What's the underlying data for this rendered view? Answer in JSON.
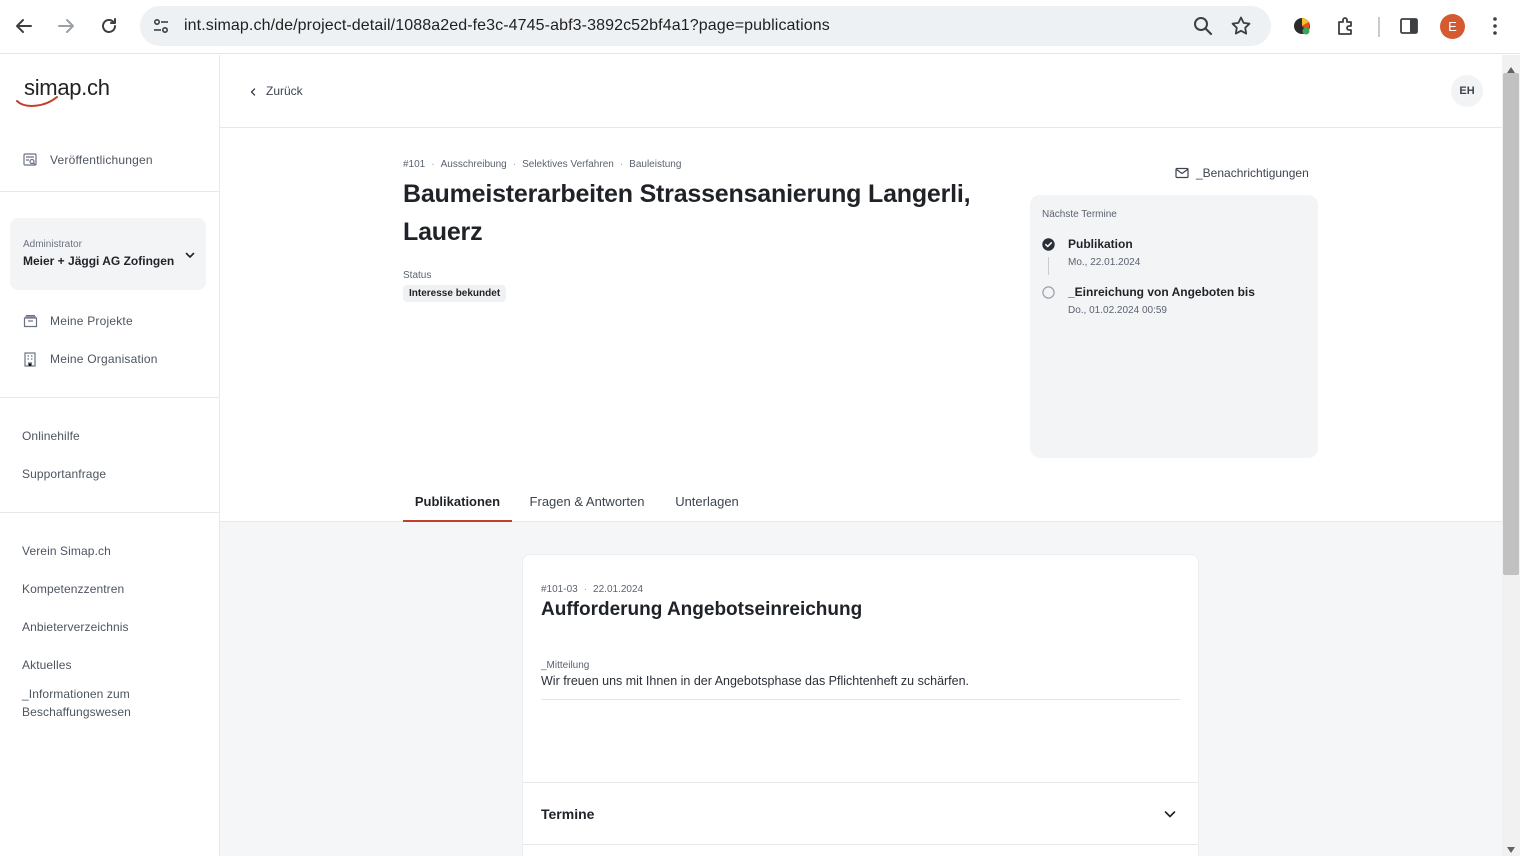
{
  "browser": {
    "url": "int.simap.ch/de/project-detail/1088a2ed-fe3c-4745-abf3-3892c52bf4a1?page=publications",
    "profile_initial": "E"
  },
  "sidebar": {
    "logo_text": "simap.ch",
    "publications_label": "Veröffentlichungen",
    "org": {
      "role": "Administrator",
      "name": "Meier + Jäggi AG Zofingen"
    },
    "projects_label": "Meine Projekte",
    "organisation_label": "Meine Organisation",
    "help_links": [
      "Onlinehilfe",
      "Supportanfrage"
    ],
    "footer_links": [
      "Verein Simap.ch",
      "Kompetenzzentren",
      "Anbieterverzeichnis",
      "Aktuelles"
    ],
    "info_link": [
      "_Informationen zum",
      "Beschaffungswesen"
    ]
  },
  "header": {
    "back_label": "Zurück",
    "avatar_initials": "EH"
  },
  "project": {
    "number": "#101",
    "type": "Ausschreibung",
    "procedure": "Selektives Verfahren",
    "category": "Bauleistung",
    "title": "Baumeisterarbeiten Strassensanierung Langerli, Lauerz",
    "status_label": "Status",
    "status_value": "Interesse bekundet",
    "notifications_label": "_Benachrichtigungen"
  },
  "next_dates": {
    "header": "Nächste Termine",
    "items": [
      {
        "label": "Publikation",
        "date": "Mo., 22.01.2024",
        "done": true
      },
      {
        "label": "_Einreichung von Angeboten bis",
        "date": "Do., 01.02.2024 00:59",
        "done": false
      }
    ]
  },
  "tabs": [
    {
      "label": "Publikationen",
      "active": true
    },
    {
      "label": "Fragen & Antworten",
      "active": false
    },
    {
      "label": "Unterlagen",
      "active": false
    }
  ],
  "publication": {
    "number": "#101-03",
    "date": "22.01.2024",
    "title": "Aufforderung Angebotseinreichung",
    "message_label": "_Mitteilung",
    "message_text": "Wir freuen uns mit Ihnen in der Angebotsphase das Pflichtenheft zu schärfen.",
    "termine_label": "Termine"
  },
  "colors": {
    "accent": "#c3412c",
    "profile": "#d65a31",
    "card_bg": "#f3f4f6"
  }
}
